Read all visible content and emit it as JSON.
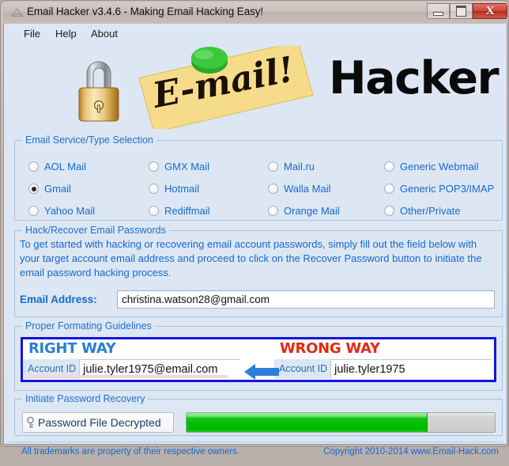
{
  "window": {
    "title": "Email Hacker v3.4.6 - Making Email Hacking Easy!",
    "icon": "envelope-icon",
    "minimize_label": "Minimize",
    "maximize_label": "Maximize",
    "close_label": "X"
  },
  "menu": {
    "items": [
      {
        "label": "File"
      },
      {
        "label": "Help"
      },
      {
        "label": "About"
      }
    ]
  },
  "banner": {
    "lock_icon": "padlock-icon",
    "note_text": "E-mail!",
    "wordmark": "Hacker"
  },
  "service_group": {
    "title": "Email Service/Type Selection",
    "options": [
      {
        "label": "AOL Mail",
        "selected": false,
        "col": 0,
        "row": 0
      },
      {
        "label": "Gmail",
        "selected": true,
        "col": 0,
        "row": 1
      },
      {
        "label": "Yahoo Mail",
        "selected": false,
        "col": 0,
        "row": 2
      },
      {
        "label": "GMX Mail",
        "selected": false,
        "col": 1,
        "row": 0
      },
      {
        "label": "Hotmail",
        "selected": false,
        "col": 1,
        "row": 1
      },
      {
        "label": "Rediffmail",
        "selected": false,
        "col": 1,
        "row": 2
      },
      {
        "label": "Mail.ru",
        "selected": false,
        "col": 2,
        "row": 0
      },
      {
        "label": "Walla Mail",
        "selected": false,
        "col": 2,
        "row": 1
      },
      {
        "label": "Orange Mail",
        "selected": false,
        "col": 2,
        "row": 2
      },
      {
        "label": "Generic Webmail",
        "selected": false,
        "col": 3,
        "row": 0
      },
      {
        "label": "Generic POP3/IMAP",
        "selected": false,
        "col": 3,
        "row": 1
      },
      {
        "label": "Other/Private",
        "selected": false,
        "col": 3,
        "row": 2
      }
    ]
  },
  "hack_group": {
    "title": "Hack/Recover Email Passwords",
    "description": "To get started with hacking or recovering email account passwords, simply fill out the field below with your target account email address and proceed to click on the Recover Password button to initiate the email password hacking process.",
    "email_label": "Email Address:",
    "email_value": "christina.watson28@gmail.com",
    "email_placeholder": ""
  },
  "format_group": {
    "title": "Proper Formating Guidelines",
    "right": {
      "heading": "RIGHT WAY",
      "heading_color": "#2a7fd4",
      "field_label": "Account ID",
      "field_value": "julie.tyler1975@email.com"
    },
    "wrong": {
      "heading": "WRONG WAY",
      "heading_color": "#e02b10",
      "field_label": "Account ID",
      "field_value": "julie.tyler1975"
    },
    "arrow_icon": "left-arrow-icon",
    "border_color": "#1414e0"
  },
  "initiate_group": {
    "title": "Initiate Password Recovery",
    "button_label": "Password File Decrypted",
    "button_icon": "key-icon",
    "progress_percent": 78,
    "progress_color": "#00c000"
  },
  "footer": {
    "left": "All trademarks are property of their respective owners.",
    "right": "Copyright 2010-2014  www.Email-Hack.com"
  }
}
